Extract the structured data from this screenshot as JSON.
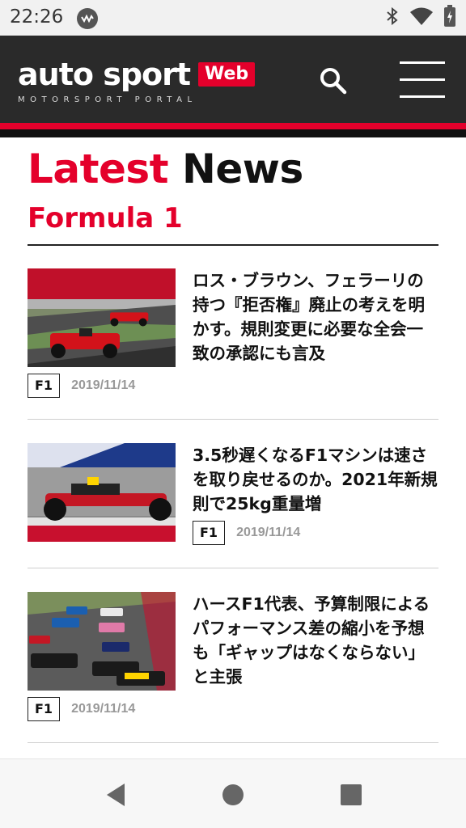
{
  "status_bar": {
    "time": "22:26",
    "icons": [
      "notification-icon",
      "bluetooth-icon",
      "wifi-icon",
      "battery-icon"
    ]
  },
  "header": {
    "logo_text": "auto sport",
    "logo_badge": "Web",
    "logo_tagline": "MOTORSPORT PORTAL",
    "icons": [
      "search-icon",
      "hamburger-menu-icon"
    ]
  },
  "colors": {
    "accent": "#e4002b",
    "header_bg": "#2a2a2a",
    "date_gray": "#999999"
  },
  "page": {
    "title_accent": "Latest",
    "title_rest": "News",
    "section": "Formula 1"
  },
  "articles": [
    {
      "title": "ロス・ブラウン、フェラーリの持つ『拒否権』廃止の考えを明かす。規則変更に必要な全会一致の承認にも言及",
      "tag": "F1",
      "date": "2019/11/14"
    },
    {
      "title": "3.5秒遅くなるF1マシンは速さを取り戻せるのか。2021年新規則で25kg重量増",
      "tag": "F1",
      "date": "2019/11/14"
    },
    {
      "title": "ハースF1代表、予算制限によるパフォーマンス差の縮小を予想も「ギャップはなくならない」と主張",
      "tag": "F1",
      "date": "2019/11/14"
    }
  ],
  "nav_bar": {
    "icons": [
      "back-icon",
      "home-icon",
      "recents-icon"
    ]
  }
}
